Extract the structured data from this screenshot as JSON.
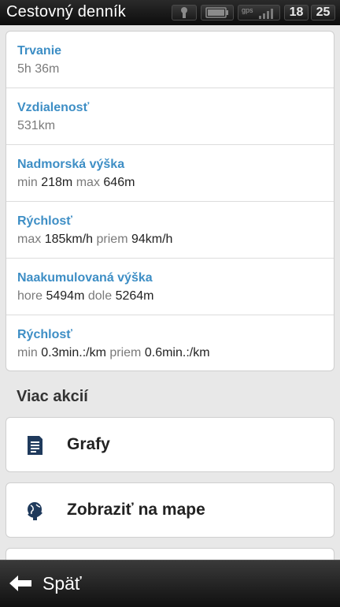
{
  "status_bar": {
    "title": "Cestovný denník",
    "gps_label": "gps",
    "clock_hour": "18",
    "clock_minute": "25"
  },
  "stats": [
    {
      "label": "Trvanie",
      "value": "5h 36m"
    },
    {
      "label": "Vzdialenosť",
      "value": "531km"
    },
    {
      "label": "Nadmorská výška",
      "k1": "min",
      "v1": "218m",
      "k2": "max",
      "v2": "646m"
    },
    {
      "label": "Rýchlosť",
      "k1": "max",
      "v1": "185km/h",
      "k2": "priem",
      "v2": "94km/h"
    },
    {
      "label": "Naakumulovaná výška",
      "k1": "hore",
      "v1": "5494m",
      "k2": "dole",
      "v2": "5264m"
    },
    {
      "label": "Rýchlosť",
      "k1": "min",
      "v1": "0.3min.:/km",
      "k2": "priem",
      "v2": "0.6min.:/km"
    }
  ],
  "more_actions": {
    "title": "Viac akcií",
    "items": [
      {
        "label": "Grafy",
        "icon": "document-icon"
      },
      {
        "label": "Zobraziť na mape",
        "icon": "globe-icon"
      }
    ]
  },
  "bottom_bar": {
    "back_label": "Späť",
    "icon": "arrow-left-icon"
  },
  "colors": {
    "accent": "#3d8ec5",
    "icon_navy": "#1f3a5c"
  }
}
